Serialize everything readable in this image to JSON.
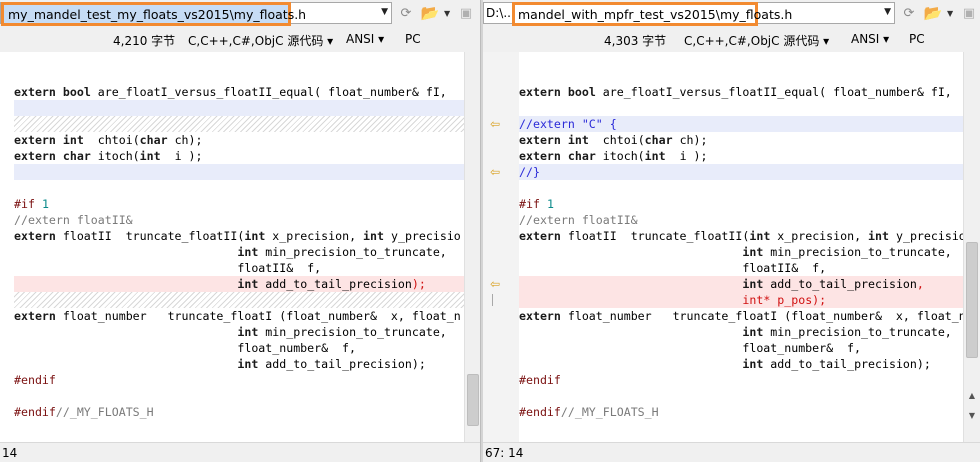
{
  "left": {
    "path": "my_mandel_test_my_floats_vs2015\\my_floats.h",
    "path_prefix": "",
    "info": {
      "size": "4,210 字节",
      "language": "C,C++,C#,ObjC 源代码",
      "encoding": "ANSI",
      "line_endings": "PC"
    },
    "status": "14",
    "lines": [
      "",
      "",
      "extern bool are_floatI_versus_floatII_equal( float_number& fI,",
      "",
      "",
      "extern int  chtoi(char ch);",
      "extern char itoch(int  i );",
      "",
      "",
      "#if 1",
      "//extern floatII&",
      "extern floatII  truncate_floatII(int x_precision, int y_precisio",
      "                                int min_precision_to_truncate,",
      "                                floatII&  f,",
      "                                int add_to_tail_precision);",
      "",
      "extern float_number   truncate_floatI (float_number&  x, float_n",
      "                                int min_precision_to_truncate,",
      "                                float_number&  f,",
      "                                int add_to_tail_precision);",
      "#endif",
      "",
      "#endif//_MY_FLOATS_H",
      ""
    ]
  },
  "right": {
    "path_prefix": "D:\\...",
    "path": "mandel_with_mpfr_test_vs2015\\my_floats.h",
    "info": {
      "size": "4,303 字节",
      "language": "C,C++,C#,ObjC 源代码",
      "encoding": "ANSI",
      "line_endings": "PC"
    },
    "status": "67: 14",
    "lines": [
      "",
      "",
      "extern bool are_floatI_versus_floatII_equal( float_number& fI,",
      "",
      "//extern \"C\" {",
      "extern int  chtoi(char ch);",
      "extern char itoch(int  i );",
      "//}",
      "",
      "#if 1",
      "//extern floatII&",
      "extern floatII  truncate_floatII(int x_precision, int y_precisio",
      "                                int min_precision_to_truncate,",
      "                                floatII&  f,",
      "                                int add_to_tail_precision,",
      "                                int* p_pos);",
      "extern float_number   truncate_floatI (float_number&  x, float_n",
      "                                int min_precision_to_truncate,",
      "                                float_number&  f,",
      "                                int add_to_tail_precision);",
      "#endif",
      "",
      "#endif//_MY_FLOATS_H",
      ""
    ]
  },
  "icons": {
    "refresh": "refresh-icon",
    "open": "folder-open-icon",
    "save": "save-icon",
    "diff_change_marker": "arrow-left-icon"
  },
  "colors": {
    "highlight_border": "#f28a30",
    "changed_line": "#e8ecfa",
    "deleted_line": "#fde4e4",
    "marker": "#d8a020"
  }
}
